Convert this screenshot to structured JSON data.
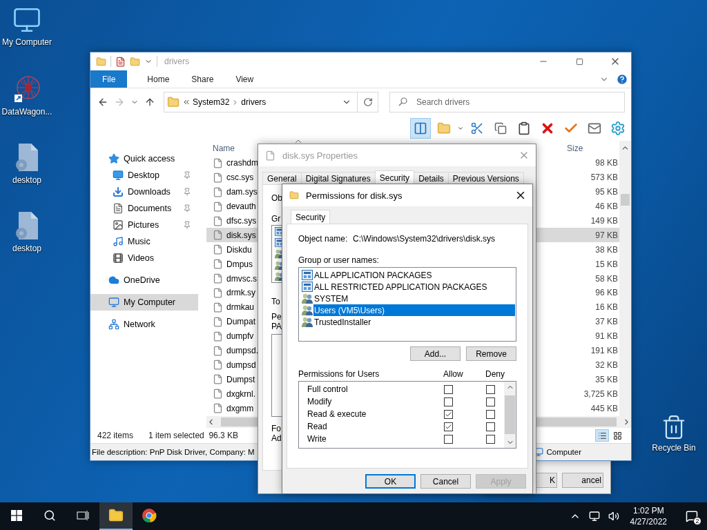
{
  "desktop_icons": [
    {
      "label": "My Computer",
      "kind": "computer"
    },
    {
      "label": "DataWagon...",
      "kind": "shortcut"
    },
    {
      "label": "desktop",
      "kind": "settings-file"
    },
    {
      "label": "desktop",
      "kind": "settings-file"
    }
  ],
  "recycle_bin": {
    "label": "Recycle Bin"
  },
  "back_dialog": {
    "buttons": [
      "K",
      "ancel"
    ]
  },
  "explorer": {
    "title": "drivers",
    "ribbon_tabs": [
      {
        "label": "File",
        "kind": "menu"
      },
      {
        "label": "Home",
        "kind": "tab"
      },
      {
        "label": "Share",
        "kind": "tab"
      },
      {
        "label": "View",
        "kind": "tab"
      }
    ],
    "address": [
      "System32",
      "drivers"
    ],
    "search": {
      "placeholder": "Search drivers"
    },
    "toolbar": {
      "preview_pane_on": true
    },
    "nav": [
      {
        "label": "Quick access",
        "kind": "star",
        "pinned": false,
        "selected": false,
        "children": [
          {
            "label": "Desktop",
            "kind": "desktop",
            "pinned": true,
            "selected": false
          },
          {
            "label": "Downloads",
            "kind": "downloads",
            "pinned": true,
            "selected": false
          },
          {
            "label": "Documents",
            "kind": "documents",
            "pinned": true,
            "selected": false
          },
          {
            "label": "Pictures",
            "kind": "pictures",
            "pinned": true,
            "selected": false
          },
          {
            "label": "Music",
            "kind": "music",
            "pinned": false,
            "selected": false
          },
          {
            "label": "Videos",
            "kind": "videos",
            "pinned": false,
            "selected": false
          }
        ]
      },
      {
        "label": "OneDrive",
        "kind": "cloud",
        "pinned": false,
        "selected": false
      },
      {
        "label": "My Computer",
        "kind": "computer",
        "pinned": false,
        "selected": true
      },
      {
        "label": "Network",
        "kind": "network",
        "pinned": false,
        "selected": false
      }
    ],
    "columns": {
      "name": "Name",
      "size": "Size"
    },
    "files": [
      {
        "name": "crashdm",
        "size": "98 KB",
        "selected": false
      },
      {
        "name": "csc.sys",
        "size": "573 KB",
        "selected": false
      },
      {
        "name": "dam.sys",
        "size": "95 KB",
        "selected": false
      },
      {
        "name": "devauth",
        "size": "46 KB",
        "selected": false
      },
      {
        "name": "dfsc.sys",
        "size": "149 KB",
        "selected": false
      },
      {
        "name": "disk.sys",
        "size": "97 KB",
        "selected": true
      },
      {
        "name": "Diskdu",
        "size": "38 KB",
        "selected": false
      },
      {
        "name": "Dmpus",
        "size": "15 KB",
        "selected": false
      },
      {
        "name": "dmvsc.s",
        "size": "58 KB",
        "selected": false
      },
      {
        "name": "drmk.sy",
        "size": "96 KB",
        "selected": false
      },
      {
        "name": "drmkau",
        "size": "16 KB",
        "selected": false
      },
      {
        "name": "Dumpat",
        "size": "37 KB",
        "selected": false
      },
      {
        "name": "dumpfv",
        "size": "91 KB",
        "selected": false
      },
      {
        "name": "dumpsd.",
        "size": "191 KB",
        "selected": false
      },
      {
        "name": "dumpsd",
        "size": "32 KB",
        "selected": false
      },
      {
        "name": "Dumpst",
        "size": "35 KB",
        "selected": false
      },
      {
        "name": "dxgkrnl.",
        "size": "3,725 KB",
        "selected": false
      },
      {
        "name": "dxgmm",
        "size": "445 KB",
        "selected": false
      }
    ],
    "status": {
      "count": "422 items",
      "selection": "1 item selected  96.3 KB",
      "details_view_on": true
    },
    "details": {
      "description": "File description: PnP Disk Driver, Company: M",
      "location": "Computer"
    }
  },
  "properties": {
    "title": "disk.sys Properties",
    "tabs": [
      {
        "label": "General",
        "selected": false
      },
      {
        "label": "Digital Signatures",
        "selected": false
      },
      {
        "label": "Security",
        "selected": true
      },
      {
        "label": "Details",
        "selected": false
      },
      {
        "label": "Previous Versions",
        "selected": false
      }
    ],
    "object_label": "Ob",
    "group_label": "Gr",
    "edit_hint": "To",
    "permissions_label": [
      "Pe",
      "PA"
    ],
    "footer": [
      "Fo",
      "Ad"
    ]
  },
  "permissions": {
    "title": "Permissions for disk.sys",
    "tabs": [
      {
        "label": "Security",
        "selected": true
      }
    ],
    "object_label": "Object name:",
    "object_value": "C:\\Windows\\System32\\drivers\\disk.sys",
    "group_label": "Group or user names:",
    "principals": [
      {
        "name": "ALL APPLICATION PACKAGES",
        "kind": "package",
        "selected": false
      },
      {
        "name": "ALL RESTRICTED APPLICATION PACKAGES",
        "kind": "package",
        "selected": false
      },
      {
        "name": "SYSTEM",
        "kind": "group",
        "selected": false
      },
      {
        "name": "Users (VM5\\Users)",
        "kind": "group",
        "selected": true
      },
      {
        "name": "TrustedInstaller",
        "kind": "group",
        "selected": false
      }
    ],
    "add": "Add...",
    "remove": "Remove",
    "perm_label": "Permissions for Users",
    "allow_label": "Allow",
    "deny_label": "Deny",
    "rights": [
      {
        "name": "Full control",
        "allow": false,
        "deny": false
      },
      {
        "name": "Modify",
        "allow": false,
        "deny": false
      },
      {
        "name": "Read & execute",
        "allow": true,
        "deny": false
      },
      {
        "name": "Read",
        "allow": true,
        "deny": false
      },
      {
        "name": "Write",
        "allow": false,
        "deny": false
      }
    ],
    "buttons": [
      {
        "label": "OK",
        "kind": "default",
        "disabled": false
      },
      {
        "label": "Cancel",
        "kind": "normal",
        "disabled": false
      },
      {
        "label": "Apply",
        "kind": "normal",
        "disabled": true
      }
    ]
  },
  "taskbar": {
    "apps": [
      {
        "kind": "explorer",
        "active": true
      },
      {
        "kind": "chrome",
        "active": false
      }
    ],
    "time": "1:02 PM",
    "date": "4/27/2022",
    "notifications": "2"
  }
}
